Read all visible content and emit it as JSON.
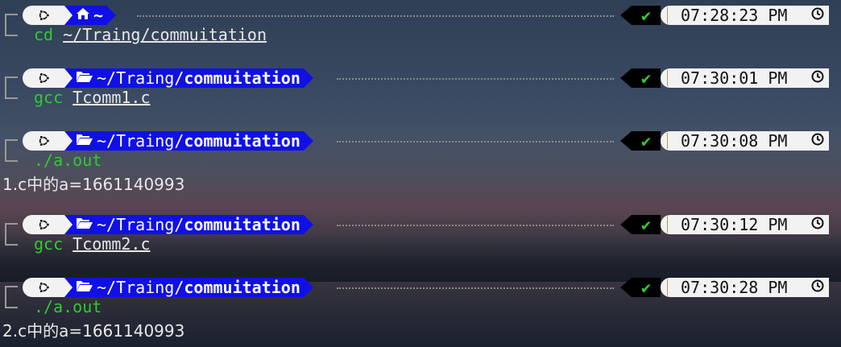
{
  "colors": {
    "dir_segment": "#1010e6",
    "os_segment": "#f2f2f2",
    "status_segment": "#000000",
    "success_check": "#2ecc2e",
    "command": "#2ecc2e"
  },
  "icons": {
    "os": "ubuntu-icon",
    "home": "home-icon",
    "folder": "folder-open-icon",
    "status": "checkmark-icon",
    "clock": "clock-icon"
  },
  "blocks": [
    {
      "dir_prefix": "",
      "dir_home": "~",
      "dir_current": "",
      "status": "✔",
      "time": "07:28:23 PM",
      "command": "cd",
      "argument": "~/Traing/commuitation",
      "output": ""
    },
    {
      "dir_prefix": "~/Traing/",
      "dir_home": "",
      "dir_current": "commuitation",
      "status": "✔",
      "time": "07:30:01 PM",
      "command": "gcc",
      "argument": "Tcomm1.c",
      "output": ""
    },
    {
      "dir_prefix": "~/Traing/",
      "dir_home": "",
      "dir_current": "commuitation",
      "status": "✔",
      "time": "07:30:08 PM",
      "command": "./a.out",
      "argument": "",
      "output": "1.c中的a=1661140993"
    },
    {
      "dir_prefix": "~/Traing/",
      "dir_home": "",
      "dir_current": "commuitation",
      "status": "✔",
      "time": "07:30:12 PM",
      "command": "gcc",
      "argument": "Tcomm2.c",
      "output": ""
    },
    {
      "dir_prefix": "~/Traing/",
      "dir_home": "",
      "dir_current": "commuitation",
      "status": "✔",
      "time": "07:30:28 PM",
      "command": "./a.out",
      "argument": "",
      "output": "2.c中的a=1661140993"
    }
  ]
}
